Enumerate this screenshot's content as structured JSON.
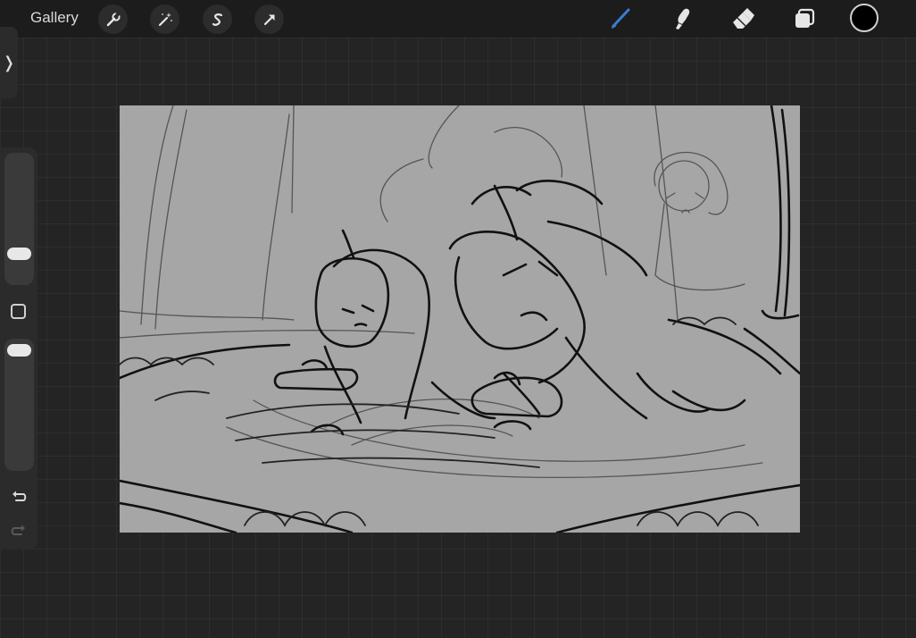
{
  "topbar": {
    "gallery_label": "Gallery",
    "actions": [
      "wrench-icon",
      "magic-wand-icon",
      "selection-icon",
      "transform-arrow-icon"
    ],
    "tools": [
      "brush-icon",
      "smudge-icon",
      "eraser-icon",
      "layers-icon"
    ],
    "active_tool": "brush",
    "accent_color": "#3a7bd5",
    "current_color": "#000000"
  },
  "sidebar": {
    "brush_size_level": 0.82,
    "opacity_level": 0.08,
    "buttons": [
      "modify-button",
      "undo-button",
      "redo-button"
    ]
  },
  "canvas": {
    "background": "#a6a6a6",
    "content": "sketch-drawing"
  }
}
